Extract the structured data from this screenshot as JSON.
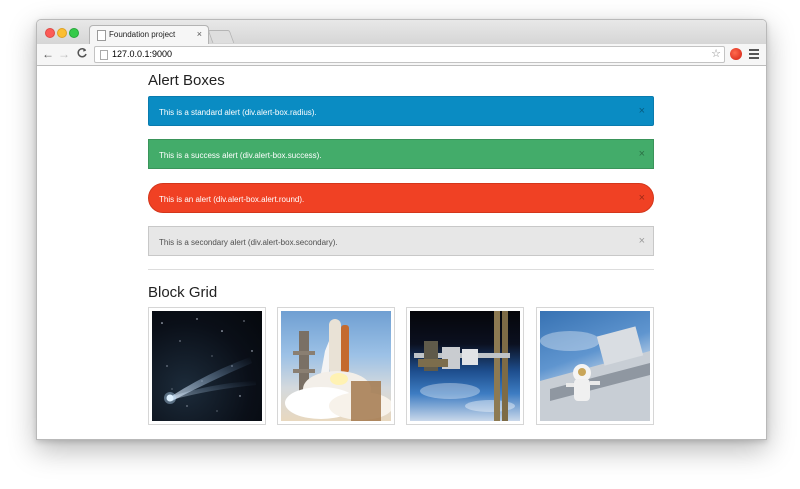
{
  "browser": {
    "tab_title": "Foundation project",
    "tab_close": "×",
    "url": "127.0.0.1:9000",
    "back": "←",
    "forward": "→",
    "reload": "C",
    "star": "☆"
  },
  "alerts_section": {
    "heading": "Alert Boxes",
    "alerts": [
      {
        "text": "This is a standard alert (div.alert-box.radius).",
        "close": "×",
        "color": "#0a8cc3"
      },
      {
        "text": "This is a success alert (div.alert-box.success).",
        "close": "×",
        "color": "#43ac6a"
      },
      {
        "text": "This is an alert (div.alert-box.alert.round).",
        "close": "×",
        "color": "#f04124"
      },
      {
        "text": "This is a secondary alert (div.alert-box.secondary).",
        "close": "×",
        "color": "#e7e7e7"
      }
    ]
  },
  "grid_section": {
    "heading": "Block Grid",
    "images": [
      {
        "icon": "comet-image"
      },
      {
        "icon": "shuttle-launch-image"
      },
      {
        "icon": "space-station-image"
      },
      {
        "icon": "astronaut-spacewalk-image"
      }
    ]
  }
}
